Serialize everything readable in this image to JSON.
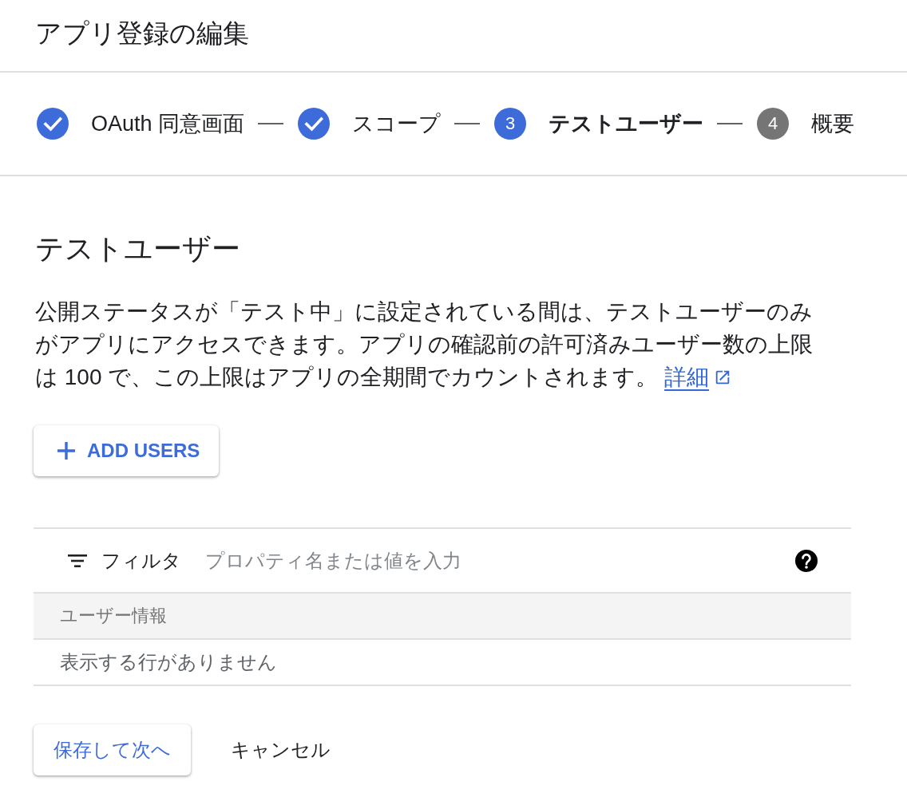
{
  "page": {
    "title": "アプリ登録の編集"
  },
  "stepper": [
    {
      "label": "OAuth 同意画面",
      "completed": true,
      "selected": false
    },
    {
      "label": "スコープ",
      "completed": true,
      "selected": false
    },
    {
      "number": "3",
      "label": "テストユーザー",
      "completed": false,
      "selected": true
    },
    {
      "number": "4",
      "label": "概要",
      "completed": false,
      "selected": false
    }
  ],
  "section": {
    "heading": "テストユーザー",
    "description": "公開ステータスが「テスト中」に設定されている間は、テストユーザーのみがアプリにアクセスできます。アプリの確認前の許可済みユーザー数の上限は 100 で、この上限はアプリの全期間でカウントされます。",
    "link": {
      "label": "詳細"
    }
  },
  "add_users_button": {
    "label": "ADD USERS"
  },
  "filter": {
    "label": "フィルタ",
    "placeholder": "プロパティ名または値を入力"
  },
  "table": {
    "columns": [
      "ユーザー情報"
    ],
    "empty_message": "表示する行がありません"
  },
  "actions": [
    {
      "label": "保存して次へ",
      "kind": "primary"
    },
    {
      "label": "キャンセル",
      "kind": "text"
    }
  ]
}
